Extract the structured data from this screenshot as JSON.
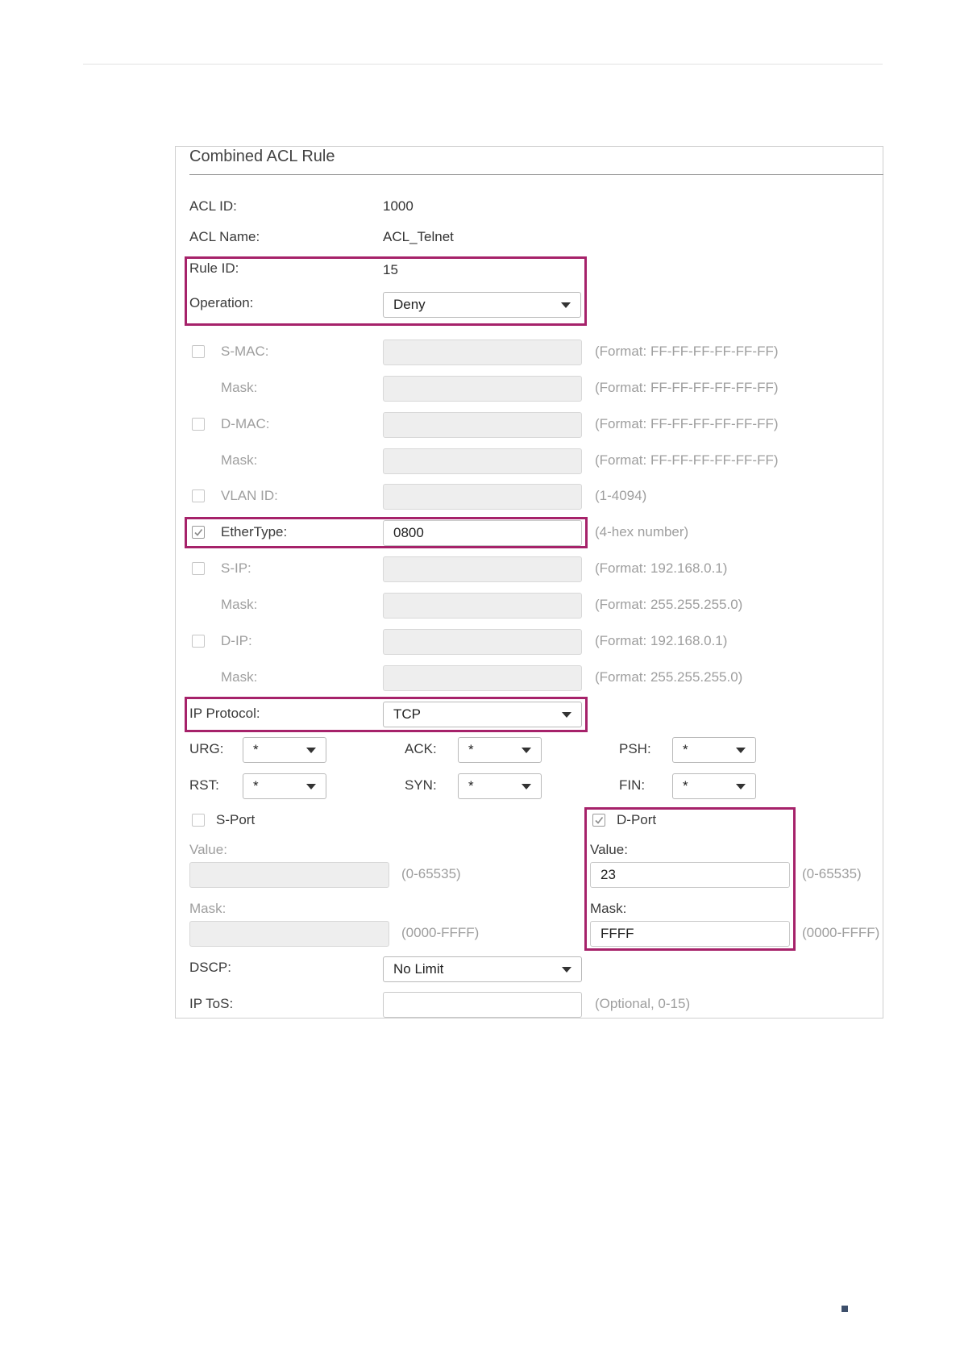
{
  "panel": {
    "title": "Combined ACL Rule"
  },
  "info": {
    "acl_id_label": "ACL ID:",
    "acl_id": "1000",
    "acl_name_label": "ACL Name:",
    "acl_name": "ACL_Telnet",
    "rule_id_label": "Rule ID:",
    "rule_id": "15",
    "operation_label": "Operation:",
    "operation": "Deny"
  },
  "mac": {
    "smac_label": "S-MAC:",
    "mask_label": "Mask:",
    "dmac_label": "D-MAC:",
    "format_hint": "(Format: FF-FF-FF-FF-FF-FF)",
    "smac_checked": false,
    "dmac_checked": false
  },
  "vlan": {
    "label": "VLAN ID:",
    "hint": "(1-4094)",
    "checked": false
  },
  "ethertype": {
    "label": "EtherType:",
    "value": "0800",
    "hint": "(4-hex number)",
    "checked": true
  },
  "ip": {
    "sip_label": "S-IP:",
    "dip_label": "D-IP:",
    "mask_label": "Mask:",
    "ip_hint": "(Format: 192.168.0.1)",
    "mask_hint": "(Format: 255.255.255.0)",
    "sip_checked": false,
    "dip_checked": false
  },
  "protocol": {
    "label": "IP Protocol:",
    "value": "TCP"
  },
  "flags": {
    "urg_label": "URG:",
    "urg": "*",
    "ack_label": "ACK:",
    "ack": "*",
    "psh_label": "PSH:",
    "psh": "*",
    "rst_label": "RST:",
    "rst": "*",
    "syn_label": "SYN:",
    "syn": "*",
    "fin_label": "FIN:",
    "fin": "*"
  },
  "sport": {
    "label": "S-Port",
    "checked": false,
    "value_label": "Value:",
    "value_hint": "(0-65535)",
    "mask_label": "Mask:",
    "mask_hint": "(0000-FFFF)"
  },
  "dport": {
    "label": "D-Port",
    "checked": true,
    "value_label": "Value:",
    "value": "23",
    "value_hint": "(0-65535)",
    "mask_label": "Mask:",
    "mask": "FFFF",
    "mask_hint": "(0000-FFFF)"
  },
  "dscp": {
    "label": "DSCP:",
    "value": "No Limit"
  },
  "tos": {
    "label": "IP ToS:",
    "hint": "(Optional, 0-15)"
  },
  "colors": {
    "highlight": "#a6226a",
    "disabled_field": "#eeeeee",
    "hint_text": "#9e9e9e"
  }
}
